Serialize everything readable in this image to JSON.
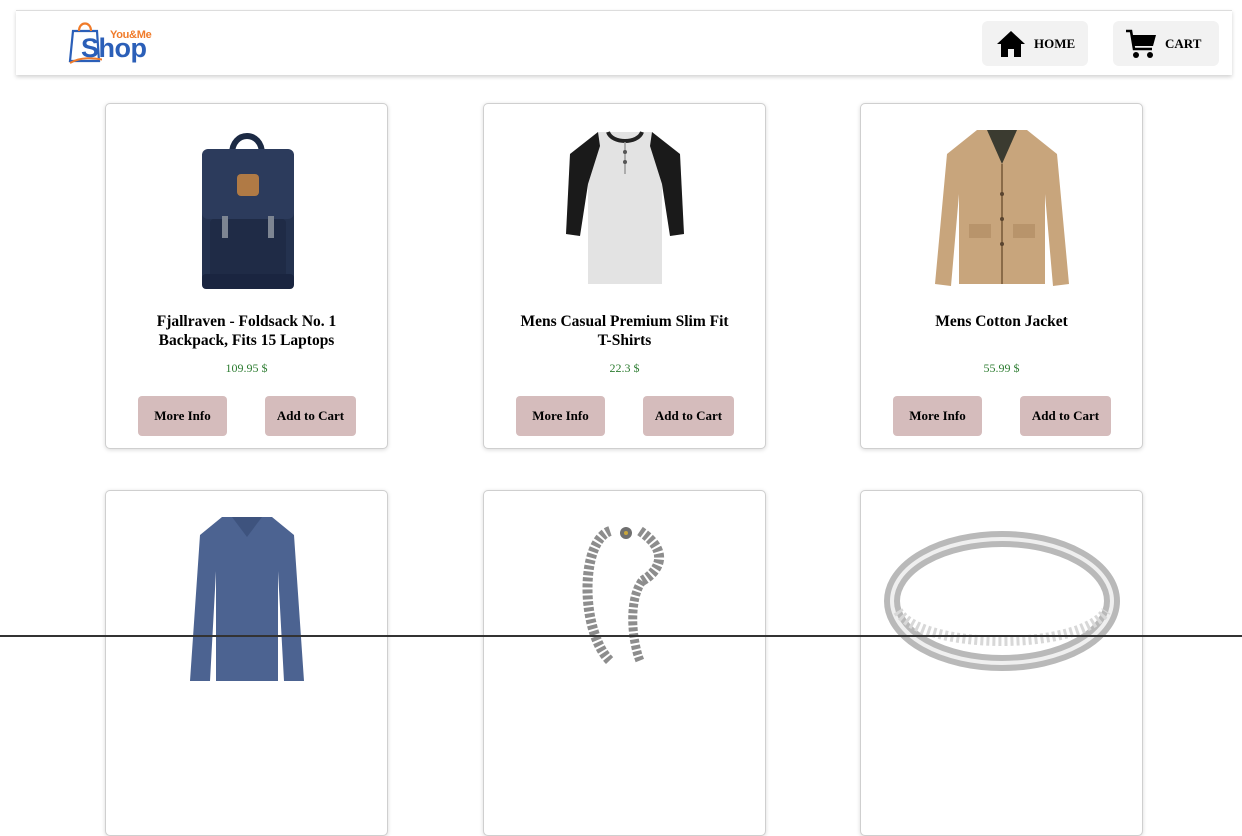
{
  "brand": {
    "small": "You&Me",
    "big": "Shop",
    "colors": {
      "blue": "#2b5fb8",
      "orange": "#f07b2a"
    }
  },
  "nav": {
    "home_label": "HOME",
    "cart_label": "CART"
  },
  "products": [
    {
      "title": "Fjallraven - Foldsack No. 1 Backpack, Fits 15 Laptops",
      "price": "109.95 $",
      "more_info": "More Info",
      "add_to_cart": "Add to Cart",
      "image": "backpack"
    },
    {
      "title": "Mens Casual Premium Slim Fit T-Shirts",
      "price": "22.3 $",
      "more_info": "More Info",
      "add_to_cart": "Add to Cart",
      "image": "raglan-tshirt"
    },
    {
      "title": "Mens Cotton Jacket",
      "price": "55.99 $",
      "more_info": "More Info",
      "add_to_cart": "Add to Cart",
      "image": "cotton-jacket"
    },
    {
      "title": "",
      "price": "",
      "image": "long-sleeve-shirt"
    },
    {
      "title": "",
      "price": "",
      "image": "silver-dragon-bracelet"
    },
    {
      "title": "",
      "price": "",
      "image": "silver-ring"
    }
  ],
  "colors": {
    "button_bg": "#d5bcbc",
    "price": "#2e7d32",
    "nav_button_bg": "#f2f2f2"
  }
}
